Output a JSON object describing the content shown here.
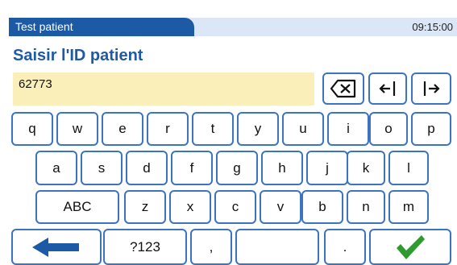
{
  "header": {
    "title": "Test patient",
    "time": "09:15:00"
  },
  "prompt": {
    "heading": "Saisir l'ID patient"
  },
  "input": {
    "value": "62773"
  },
  "keyboard": {
    "row1": [
      "q",
      "w",
      "e",
      "r",
      "t",
      "y",
      "u",
      "i",
      "o",
      "p"
    ],
    "row2": [
      "a",
      "s",
      "d",
      "f",
      "g",
      "h",
      "j",
      "k",
      "l"
    ],
    "row3": {
      "mode": "ABC",
      "letters": [
        "z",
        "x",
        "c",
        "v",
        "b",
        "n",
        "m"
      ]
    },
    "row4": {
      "symbols": "?123",
      "comma": ",",
      "period": "."
    },
    "icons": {
      "backspace": "backspace-icon",
      "cursor_left": "cursor-left-icon",
      "cursor_right": "cursor-right-icon",
      "back": "back-arrow-icon",
      "confirm": "checkmark-icon"
    }
  },
  "colors": {
    "accent": "#1d5aa5",
    "key_border": "#3b74c1",
    "field_bg": "#faefb9",
    "confirm": "#2e9b2e"
  }
}
